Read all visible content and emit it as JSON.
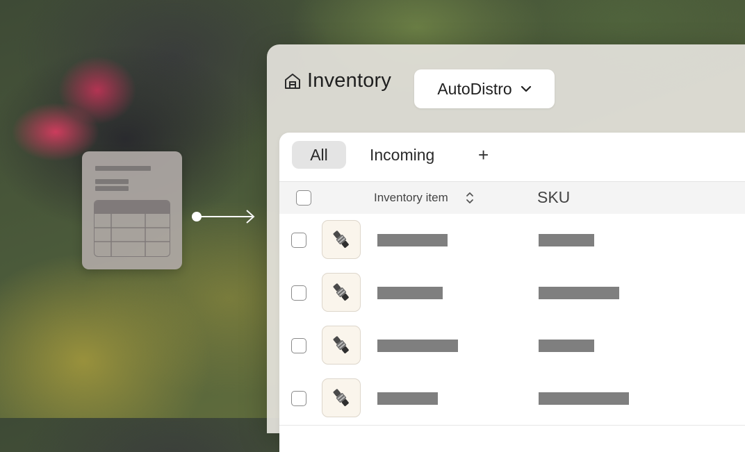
{
  "header": {
    "title": "Inventory",
    "store_select": "AutoDistro"
  },
  "tabs": [
    {
      "label": "All",
      "active": true
    },
    {
      "label": "Incoming",
      "active": false
    },
    {
      "label": "+",
      "active": false
    }
  ],
  "table": {
    "columns": [
      "Inventory item",
      "SKU"
    ],
    "rows": [
      {
        "item": "",
        "sku": ""
      },
      {
        "item": "",
        "sku": ""
      },
      {
        "item": "",
        "sku": ""
      },
      {
        "item": "",
        "sku": ""
      }
    ]
  },
  "icons": {
    "header": "warehouse-icon",
    "select": "chevron-down-icon",
    "sort": "sort-icon",
    "import": "document-icon"
  },
  "colors": {
    "panel": "#e4e2dc",
    "active_tab": "#e4e4e4",
    "redacted_bar": "#7f7f7f",
    "thumbnail_bg": "#faf5ec"
  }
}
